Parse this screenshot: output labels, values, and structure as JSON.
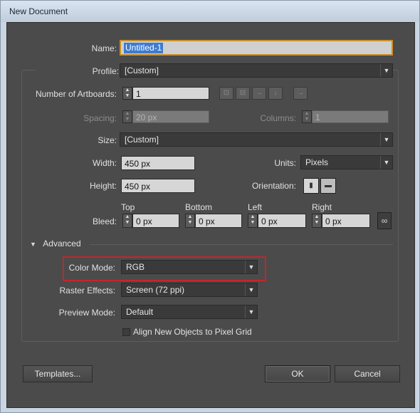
{
  "window": {
    "title": "New Document"
  },
  "form": {
    "name": {
      "label": "Name:",
      "value": "Untitled-1"
    },
    "profile": {
      "label": "Profile:",
      "value": "[Custom]"
    },
    "artboards": {
      "label": "Number of Artboards:",
      "value": "1"
    },
    "spacing": {
      "label": "Spacing:",
      "value": "20 px"
    },
    "columns": {
      "label": "Columns:",
      "value": "1"
    },
    "size": {
      "label": "Size:",
      "value": "[Custom]"
    },
    "width": {
      "label": "Width:",
      "value": "450 px"
    },
    "height": {
      "label": "Height:",
      "value": "450 px"
    },
    "units": {
      "label": "Units:",
      "value": "Pixels"
    },
    "orientation": {
      "label": "Orientation:"
    },
    "bleed": {
      "label": "Bleed:",
      "top": {
        "label": "Top",
        "value": "0 px"
      },
      "bottom": {
        "label": "Bottom",
        "value": "0 px"
      },
      "left": {
        "label": "Left",
        "value": "0 px"
      },
      "right": {
        "label": "Right",
        "value": "0 px"
      }
    }
  },
  "advanced": {
    "label": "Advanced",
    "color_mode": {
      "label": "Color Mode:",
      "value": "RGB"
    },
    "raster_effects": {
      "label": "Raster Effects:",
      "value": "Screen (72 ppi)"
    },
    "preview_mode": {
      "label": "Preview Mode:",
      "value": "Default"
    },
    "align_pixel_grid": {
      "label": "Align New Objects to Pixel Grid",
      "checked": false
    }
  },
  "buttons": {
    "templates": "Templates...",
    "ok": "OK",
    "cancel": "Cancel"
  },
  "colors": {
    "highlight": "#c4262a",
    "selection": "#3d7bd0",
    "focus_border": "#c8902a"
  },
  "icons": [
    "spin-up-icon",
    "spin-down-icon",
    "grid-by-row-icon",
    "grid-by-column-icon",
    "arrange-by-row-icon",
    "arrange-by-column-icon",
    "right-to-left-icon",
    "portrait-icon",
    "landscape-icon",
    "link-icon",
    "disclosure-triangle-icon",
    "dropdown-arrow-icon"
  ]
}
